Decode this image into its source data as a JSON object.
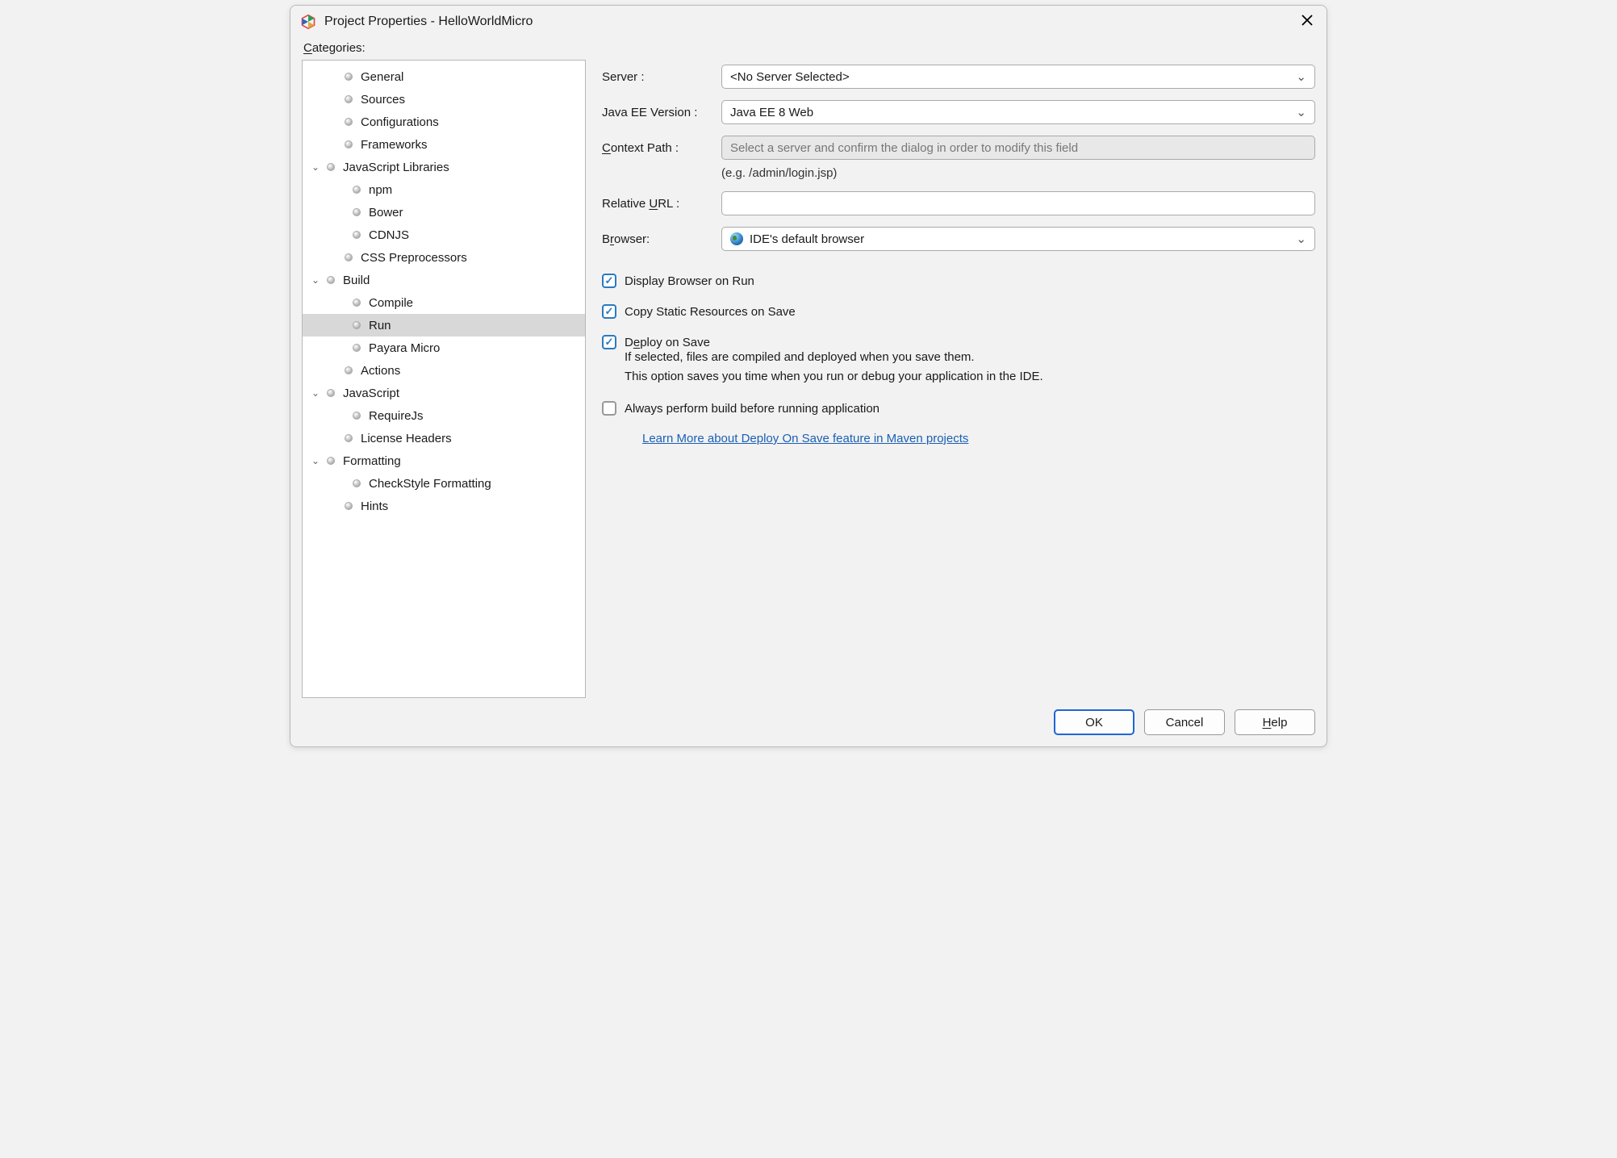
{
  "title": "Project Properties - HelloWorldMicro",
  "categories_label": "Categories:",
  "tree": {
    "general": "General",
    "sources": "Sources",
    "configurations": "Configurations",
    "frameworks": "Frameworks",
    "js_libraries": "JavaScript Libraries",
    "npm": "npm",
    "bower": "Bower",
    "cdnjs": "CDNJS",
    "css_preprocessors": "CSS Preprocessors",
    "build": "Build",
    "compile": "Compile",
    "run": "Run",
    "payara_micro": "Payara Micro",
    "actions": "Actions",
    "javascript": "JavaScript",
    "requirejs": "RequireJs",
    "license_headers": "License Headers",
    "formatting": "Formatting",
    "checkstyle_formatting": "CheckStyle Formatting",
    "hints": "Hints"
  },
  "form": {
    "server_label": "Server :",
    "server_value": "<No Server Selected>",
    "javaee_label": "Java EE Version :",
    "javaee_value": "Java EE 8 Web",
    "context_path_label": "Context Path :",
    "context_path_placeholder": "Select a server and confirm the dialog in order to modify this field",
    "context_path_hint": "(e.g. /admin/login.jsp)",
    "relative_url_label": "Relative URL :",
    "relative_url_value": "",
    "browser_label": "Browser:",
    "browser_value": "IDE's default browser",
    "display_browser": "Display Browser on Run",
    "copy_static": "Copy Static Resources on Save",
    "deploy_on_save": "Deploy on Save",
    "deploy_desc1": "If selected, files are compiled and deployed when you save them.",
    "deploy_desc2": "This option saves you time when you run or debug your application in the IDE.",
    "always_build": "Always perform build before running application",
    "learn_more": "Learn More about Deploy On Save feature in Maven projects"
  },
  "buttons": {
    "ok": "OK",
    "cancel": "Cancel",
    "help": "Help"
  }
}
